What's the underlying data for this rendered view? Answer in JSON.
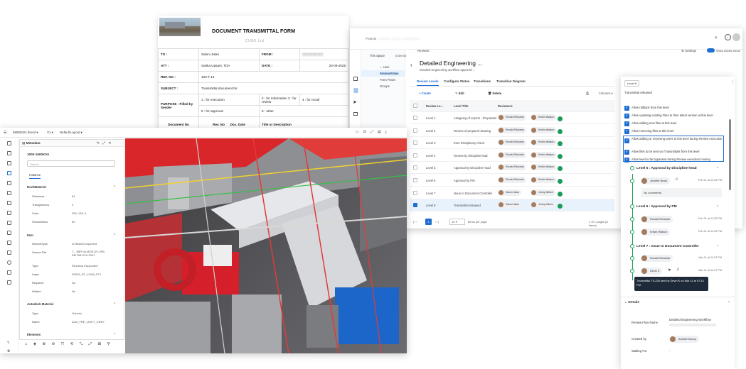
{
  "transmittal": {
    "title": "DOCUMENT TRANSMITTAL FORM",
    "subtitle": "CUBE Ltd",
    "to_label": "TO :",
    "to_value": "Saloni Jalan",
    "from_label": "FROM :",
    "att_label": "ATT :",
    "att_value": "Sarika Upsani, TDA",
    "date_label": "DATE :",
    "date_value": "20-09-2025",
    "ref_label": "REF. NO :",
    "ref_value": "100-T-13",
    "subject_label": "SUBJECT :",
    "subject_value": "Transmittal document for",
    "purpose_label": "PURPOSE : Filled by Sender",
    "purpose_items": [
      "1 : for execution",
      "2 : for information",
      "3 : for review",
      "4 : for recall",
      "5 : for approval",
      "6 : other"
    ],
    "col_doc": "Document No",
    "col_rev": "Rev. No",
    "col_date": "Doc. Date",
    "col_title": "Title or Description"
  },
  "review": {
    "breadcrumb": "Projects",
    "tab_space": "This Space",
    "tab_external": "External",
    "reviews_label": "Reviews",
    "settings_label": "Settings",
    "show_hidden_label": "Show hidden items",
    "nav": [
      "User Administration",
      "Review Flows",
      "Form Flows",
      "Groups"
    ],
    "page_title": "Detailed Engineering ...",
    "page_subtitle": "Detailed Engineering workflow approval ...",
    "tabs": [
      "Review Levels",
      "Configure Status",
      "Transitions",
      "Transition Diagram"
    ],
    "create_label": "Create",
    "edit_label": "Edit",
    "delete_label": "Delete",
    "columns_label": "Columns",
    "col_level": "Review Le...",
    "col_title": "Level Title",
    "col_reviewers": "Reviewers",
    "rows": [
      {
        "level": "Level 1",
        "title": "Assigning of reports - Preparation of ...",
        "r1": "Ronald Richards",
        "r2": "Kristin Watson",
        "g": "1"
      },
      {
        "level": "Level 2",
        "title": "Review of prepared drawing",
        "r1": "Ronald Richards",
        "r2": "Kristin Watson",
        "g": "2"
      },
      {
        "level": "Level 3",
        "title": "Inter-Disciplinary check",
        "r1": "Ronald Richards",
        "r2": "Kristin Watson",
        "g": "3"
      },
      {
        "level": "Level 4",
        "title": "Review by Discipline lead",
        "r1": "Ronald Richards",
        "r2": "Kristin Watson",
        "g": "4"
      },
      {
        "level": "Level 5",
        "title": "Approval by Discipline head",
        "r1": "Ronald Richards",
        "r2": "Kristin Watson",
        "g": "5"
      },
      {
        "level": "Level 6",
        "title": "Approval by PM",
        "r1": "Ronald Richards",
        "r2": "Kristin Watson",
        "g": "6"
      },
      {
        "level": "Level 7",
        "title": "Issue to Document Controller",
        "r1": "Saloni Jalan",
        "r2": "Jenny Wilson",
        "g": "7"
      },
      {
        "level": "Level 8",
        "title": "Transmittal released",
        "r1": "Saloni Jalan",
        "r2": "Jenny Wilson",
        "g": "8"
      }
    ],
    "page_number": "1",
    "page_size": "10",
    "per_page_label": "Items per page",
    "page_count_label": "1 of 1 pages (8 items)"
  },
  "panel": {
    "level_badge": "Level 8",
    "level_title": "Transmittal released",
    "options": [
      "Allow rollback from this level",
      "Allow updating existing Files to their latest version at this level",
      "Allow adding new files at this level",
      "Allow removing files at this level",
      "Allow adding or removing users to this level during Review execution",
      "Allow files to be sent via Transmittals from this level",
      "Allow level to be bypassed during Review execution moving"
    ],
    "l5": "Level 5 : Approval by Discipline head",
    "l5_user": "Jennifer Brock",
    "l5_time": "Feb 21 at 11:20 PM",
    "no_comments": "No comments.",
    "l6": "Level 6 : Approval by PM",
    "l6_u1": "Ronald Richards",
    "l6_t1": "Feb 21 at 11:20 PM",
    "l6_u2": "Kristin Watson",
    "l6_t2": "Feb 21 at 11:20 PM",
    "l7": "Level 7 : Issue to Document Controller",
    "l7_u1": "Ronald Richards",
    "l7_t1": "Mar 11 at 11:07 PM",
    "l7_u2": "Devin K",
    "l7_t2": "Mar 11 at 11:07 PM",
    "tooltip": "Transmittal TS-230 sent by Devin K on Mar 11 at 07:13 PM",
    "details_label": "Details",
    "flow_name_label": "Review Flow Name",
    "flow_name_value": "Detailed Engineering Workflow",
    "created_by_label": "Created by",
    "created_by_value": "Antoine Mccoy",
    "waiting_label": "Waiting For",
    "waiting_value": "-"
  },
  "viewer": {
    "file_name": "06092024.ifcxml",
    "view_id": "V1",
    "layout": "Default Layout",
    "meta_title": "Metadata",
    "element_id": "1000-1500KVA",
    "search_placeholder": "Search",
    "instance_tab": "Instance",
    "rev_material": "RevitMaterial",
    "shininess_l": "Shininess",
    "shininess_v": "64",
    "transparency_l": "Transparency",
    "transparency_v": "0",
    "color_l": "Color",
    "color_v": "255, 128, 0",
    "smoothness_l": "Smoothness",
    "smoothness_v": "50",
    "item_sect": "Item",
    "internal_type_l": "InternalType",
    "internal_type_v": "ioTBuildComponent",
    "source_file_l": "Source File",
    "source_file_v": "T... MEP-M-MCR-DF-2R5-SM RM-ZC0-2021",
    "type_l": "Type",
    "type_v": "Electrical Equipment",
    "layer_l": "Layer",
    "layer_v": "P0025_EF_11000_FT1",
    "required_l": "Required",
    "required_v": "No",
    "hidden_l": "Hidden",
    "hidden_v": "No",
    "autodesk_sect": "Autodesk Material",
    "atype_l": "Type",
    "atype_v": "Generic",
    "aname_l": "Name",
    "aname_v": "ALM_FRE_LIGHT_GREY",
    "elements_sect": "Elements"
  }
}
